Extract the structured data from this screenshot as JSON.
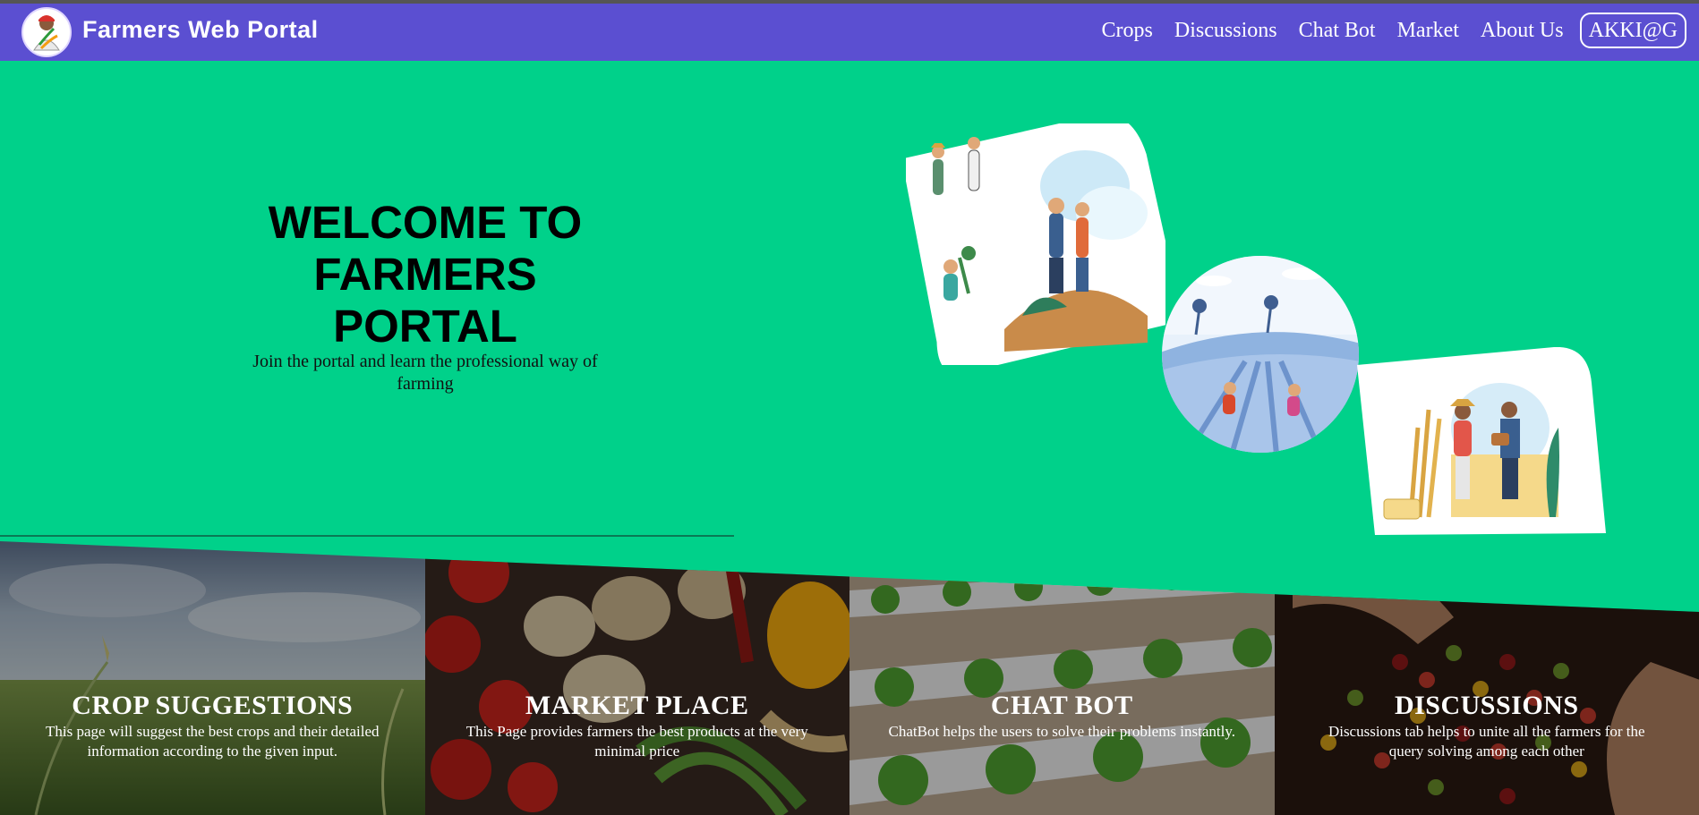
{
  "navbar": {
    "brand": "Farmers Web Portal",
    "links": [
      "Crops",
      "Discussions",
      "Chat Bot",
      "Market",
      "About Us"
    ],
    "user": "AKKI@G"
  },
  "hero": {
    "title": "WELCOME TO FARMERS PORTAL",
    "subtitle": "Join the portal and learn the professional way of farming"
  },
  "cards": [
    {
      "title": "CROP SUGGESTIONS",
      "text": "This page will suggest the best crops and their detailed information according to the given input."
    },
    {
      "title": "MARKET PLACE",
      "text": "This Page provides farmers the best products at the very minimal price"
    },
    {
      "title": "CHAT BOT",
      "text": "ChatBot helps the users to solve their problems instantly."
    },
    {
      "title": "DISCUSSIONS",
      "text": "Discussions tab helps to unite all the farmers for the query solving among each other"
    }
  ],
  "colors": {
    "navbar": "#5b4fd1",
    "hero": "#00d18a"
  }
}
